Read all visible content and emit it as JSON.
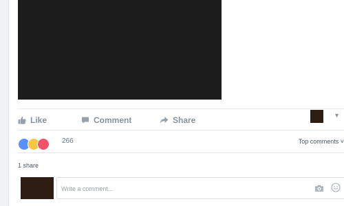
{
  "post": {
    "actions": {
      "like_label": "Like",
      "comment_label": "Comment",
      "share_label": "Share"
    },
    "reactions": {
      "count": "266",
      "top_comments_label": "Top comments ˅"
    },
    "shares": {
      "text": "1 share"
    },
    "comment_box": {
      "placeholder": "Write a comment..."
    }
  },
  "colors": {
    "like_reaction": "#5890ff",
    "haha_reaction": "#f7c744",
    "love_reaction": "#f25268",
    "media_bg": "#1c1c1c",
    "avatar_bg": "#2e1d12"
  },
  "icons": {
    "like": "thumbs-up-icon",
    "comment": "comment-bubble-icon",
    "share": "share-arrow-icon",
    "camera": "camera-icon",
    "emoji": "smile-icon"
  }
}
